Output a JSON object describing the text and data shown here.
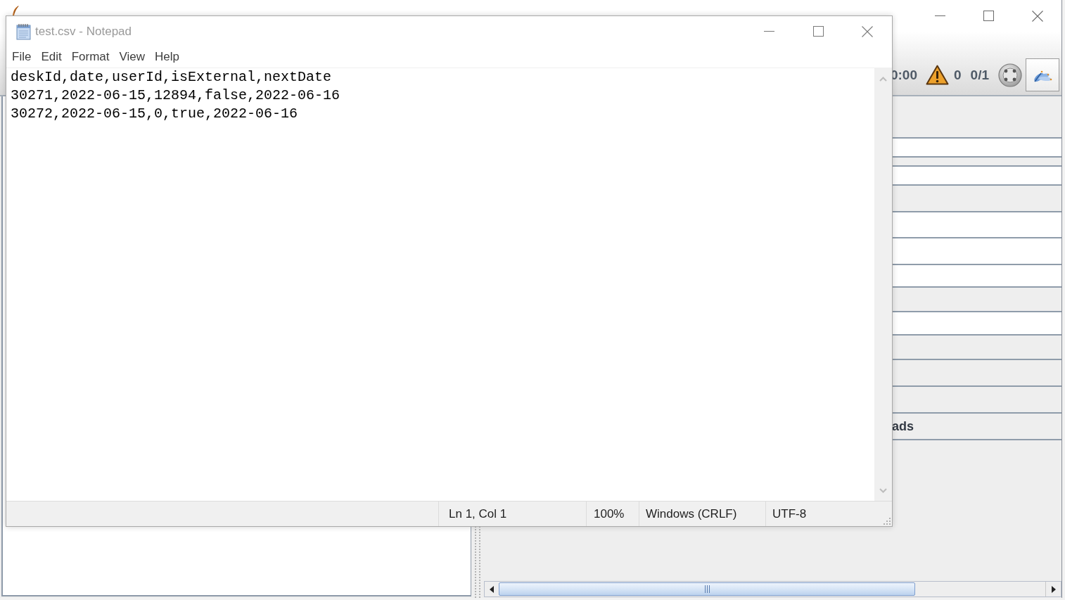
{
  "jmeter_window": {
    "toolbar": {
      "elapsed_time": "0:00",
      "warning_count": "0",
      "active_threads": "0/1"
    },
    "panel": {
      "label": "ads"
    }
  },
  "notepad": {
    "title": "test.csv - Notepad",
    "menu": [
      "File",
      "Edit",
      "Format",
      "View",
      "Help"
    ],
    "lines": [
      "deskId,date,userId,isExternal,nextDate",
      "30271,2022-06-15,12894,false,2022-06-16",
      "30272,2022-06-15,0,true,2022-06-16"
    ],
    "status_bar": [
      "Ln 1, Col 1",
      "100%",
      "Windows (CRLF)",
      "UTF-8"
    ]
  }
}
